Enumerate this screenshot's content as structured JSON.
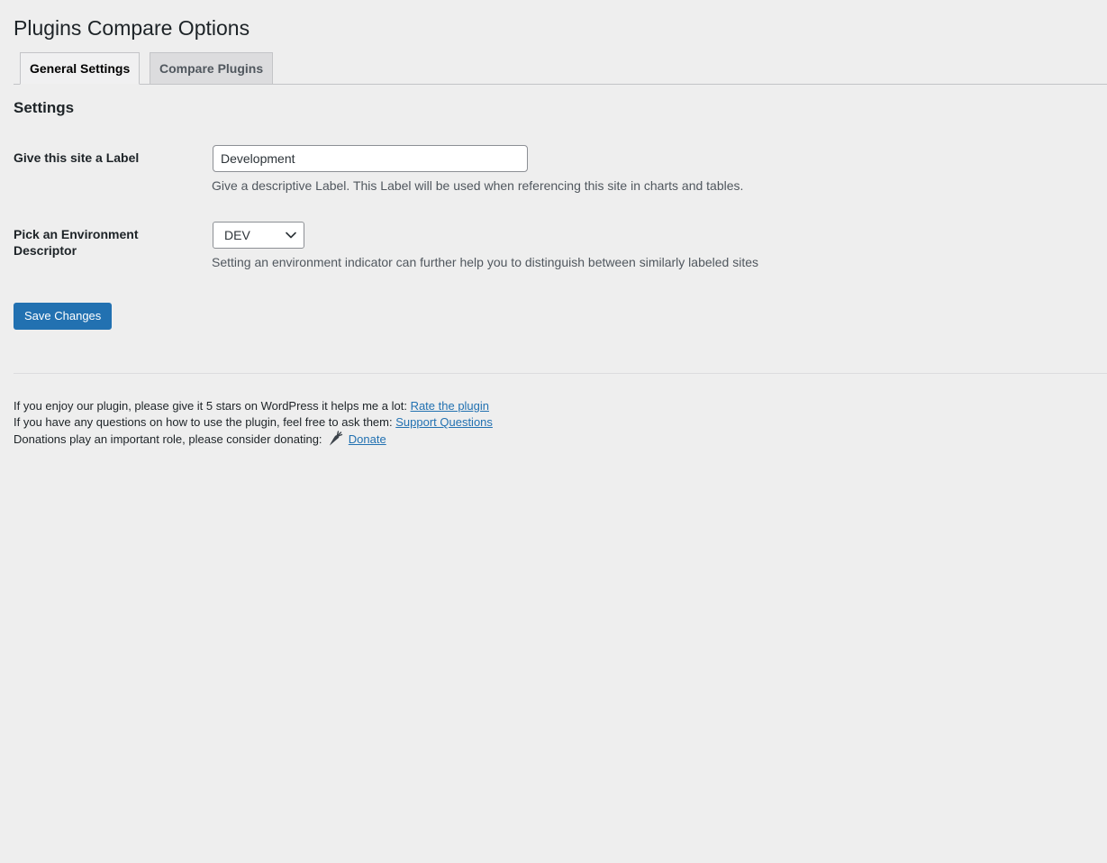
{
  "page": {
    "title": "Plugins Compare Options"
  },
  "tabs": [
    {
      "label": "General Settings",
      "active": true
    },
    {
      "label": "Compare Plugins",
      "active": false
    }
  ],
  "settings": {
    "section_title": "Settings",
    "label_field": {
      "label": "Give this site a Label",
      "value": "Development",
      "description": "Give a descriptive Label. This Label will be used when referencing this site in charts and tables."
    },
    "environment_field": {
      "label": "Pick an Environment Descriptor",
      "selected": "DEV",
      "description": "Setting an environment indicator can further help you to distinguish between similarly labeled sites"
    },
    "save_label": "Save Changes"
  },
  "footer": {
    "rate_text": "If you enjoy our plugin, please give it 5 stars on WordPress it helps me a lot:",
    "rate_link": "Rate the plugin",
    "support_text": "If you have any questions on how to use the plugin, feel free to ask them:",
    "support_link": "Support Questions",
    "donate_text": "Donations play an important role, please consider donating:",
    "donate_icon": "carrot-icon",
    "donate_link": "Donate"
  },
  "colors": {
    "accent": "#2271b1",
    "background": "#eeeeee"
  }
}
